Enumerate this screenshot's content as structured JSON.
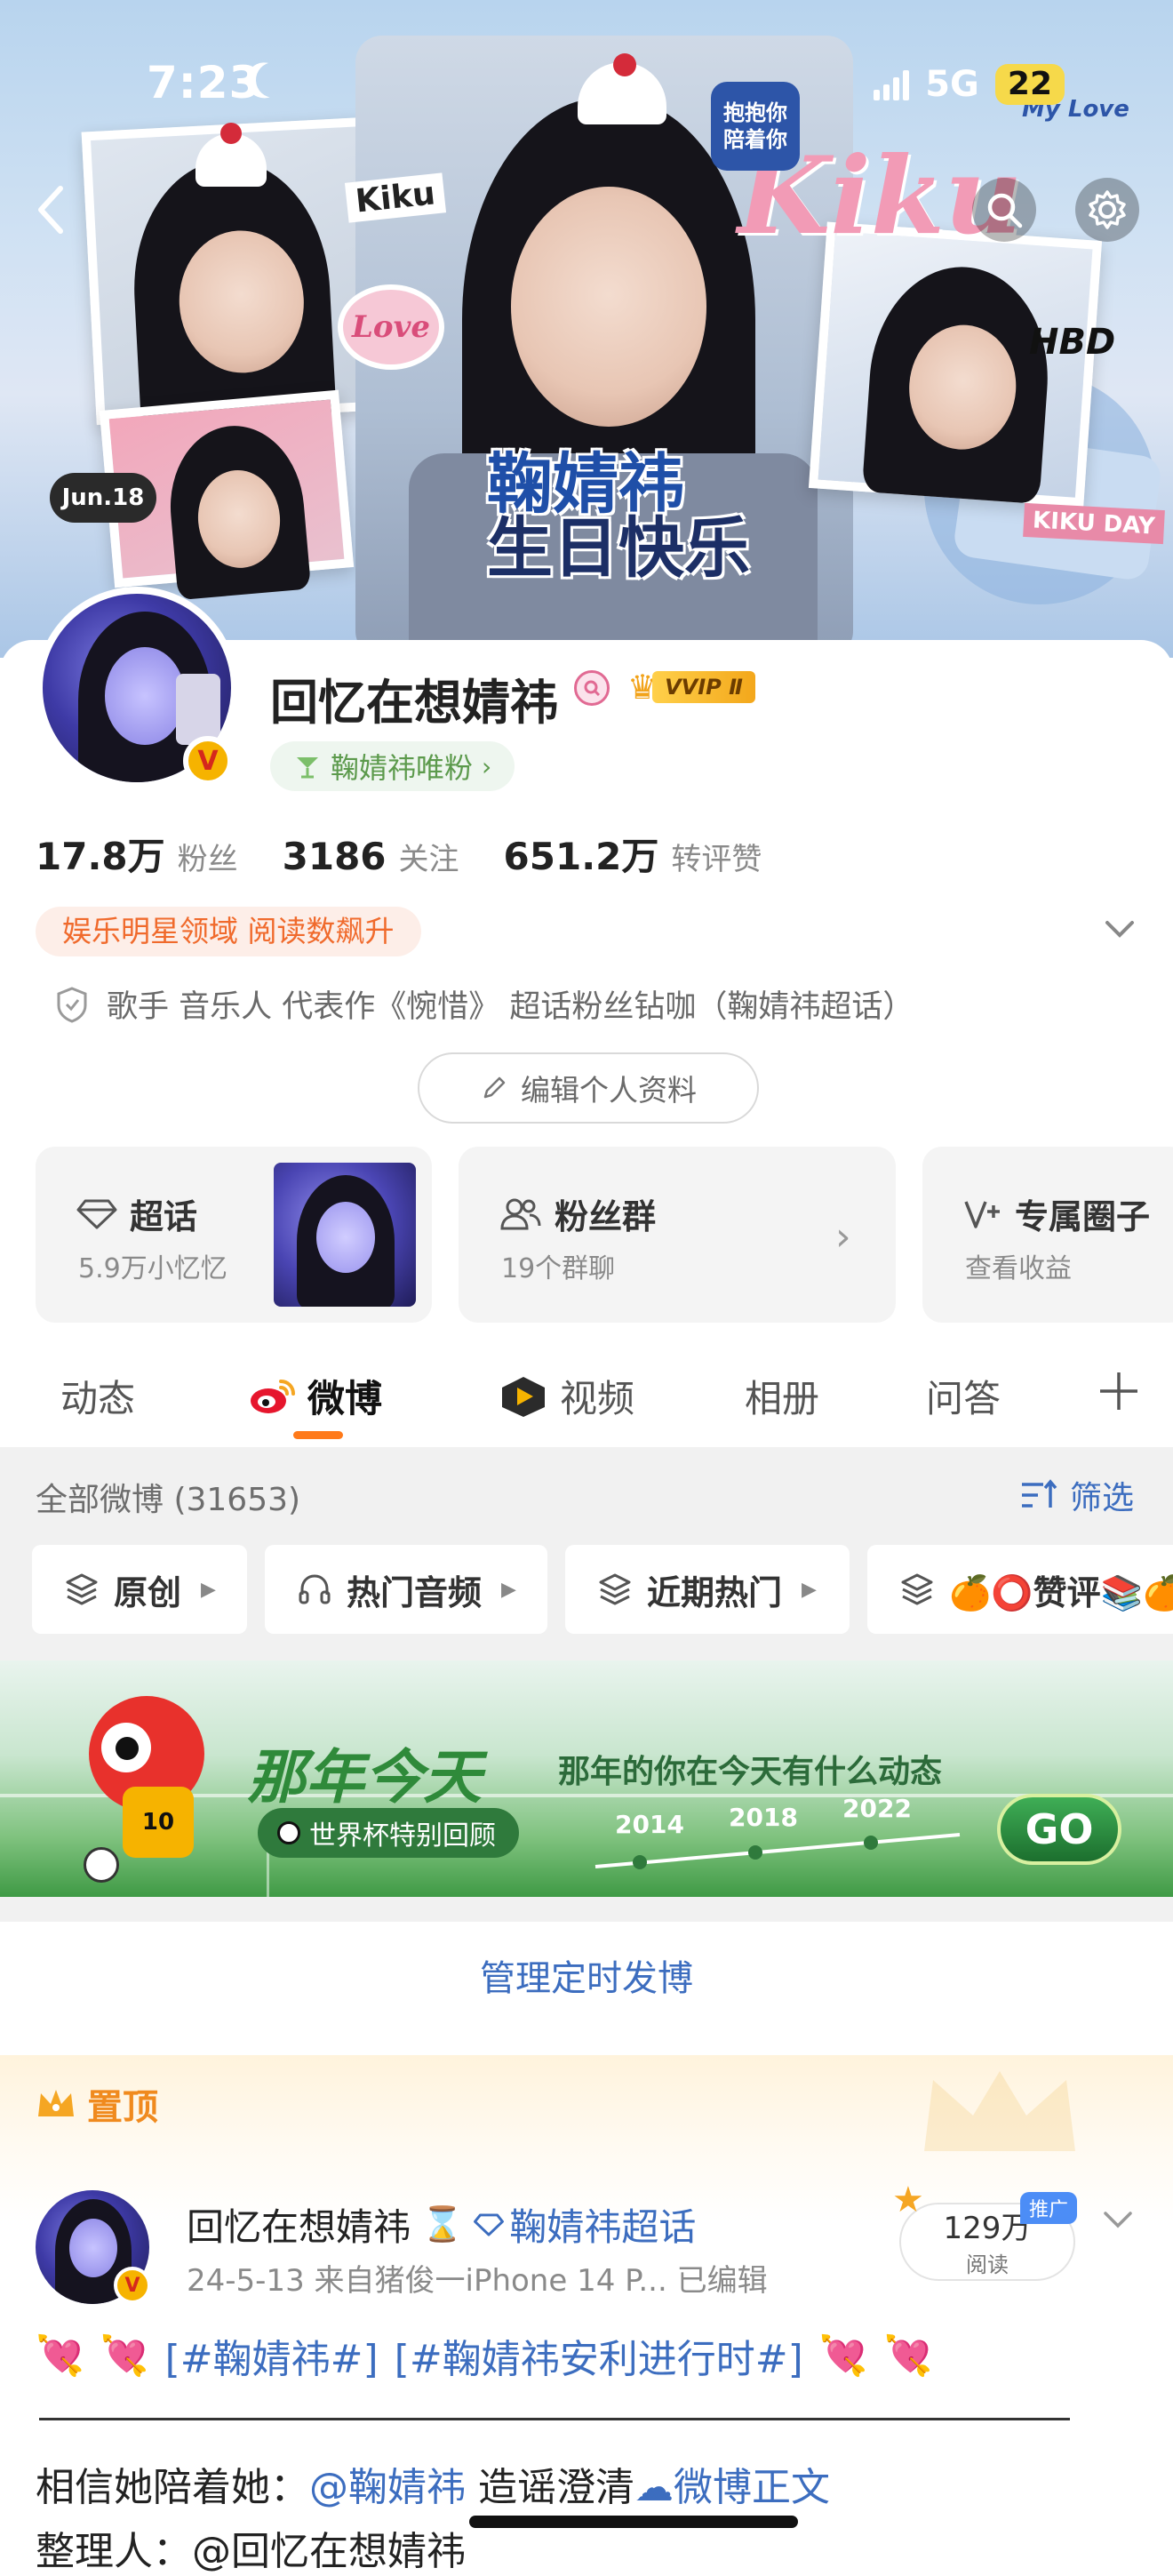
{
  "status_bar": {
    "time": "7:23",
    "network": "5G",
    "battery": "22"
  },
  "banner": {
    "title_line1": "鞠婧祎",
    "title_line2": "生日快乐",
    "script_text": "Kiku",
    "tag_text": "Kiku",
    "love_text": "Love",
    "date_sticker": "Jun.18",
    "hbd_text": "HBD",
    "kikuday_text": "KIKU DAY",
    "mylove_text": "My Love",
    "bubble_text": "抱抱你 陪着你"
  },
  "profile": {
    "name": "回忆在想婧祎",
    "vvip": "VVIP Ⅱ",
    "fan_tag": "鞠婧祎唯粉",
    "followers_num": "17.8万",
    "followers_label": "粉丝",
    "following_num": "3186",
    "following_label": "关注",
    "likes_num": "651.2万",
    "likes_label": "转评赞",
    "domain_tag": "娱乐明星领域 阅读数飙升",
    "bio": "歌手 音乐人 代表作《惋惜》 超话粉丝钻咖（鞠婧祎超话）",
    "edit_button": "编辑个人资料"
  },
  "features": [
    {
      "title": "超话",
      "sub": "5.9万小忆忆"
    },
    {
      "title": "粉丝群",
      "sub": "19个群聊"
    },
    {
      "title": "专属圈子",
      "sub": "查看收益"
    }
  ],
  "tabs": [
    "动态",
    "微博",
    "视频",
    "相册",
    "问答"
  ],
  "feed": {
    "all_count": "全部微博 (31653)",
    "filter_label": "筛选",
    "chips": [
      "原创",
      "热门音频",
      "近期热门",
      "🍊⭕赞评📚🍊"
    ]
  },
  "ad": {
    "title": "那年今天",
    "subtitle": "那年的你在今天有什么动态",
    "pill": "世界杯特别回顾",
    "years": [
      "2014",
      "2018",
      "2022"
    ],
    "go": "GO",
    "jersey": "10"
  },
  "manage_label": "管理定时发博",
  "pinned": {
    "label": "置顶",
    "author": "回忆在想婧祎",
    "topic_link": "鞠婧祎超话",
    "meta": "24-5-13  来自猪俊一iPhone 14 P...  已编辑",
    "read_count": "129万",
    "read_label": "阅读",
    "promo": "推广",
    "line1_tag1": "[#鞠婧祎#]",
    "line1_tag2": "[#鞠婧祎安利进行时#]",
    "line2_prefix": "相信她陪着她：",
    "line2_mention": "@鞠婧祎",
    "line2_mid": " 造谣澄清",
    "line2_link": "微博正文",
    "line3": "整理人：@回忆在想婧祎"
  },
  "colors": {
    "accent": "#ff7a1a",
    "link": "#3c6dbf",
    "tag_bg": "#fdeee8",
    "tag_fg": "#f06a2c"
  }
}
